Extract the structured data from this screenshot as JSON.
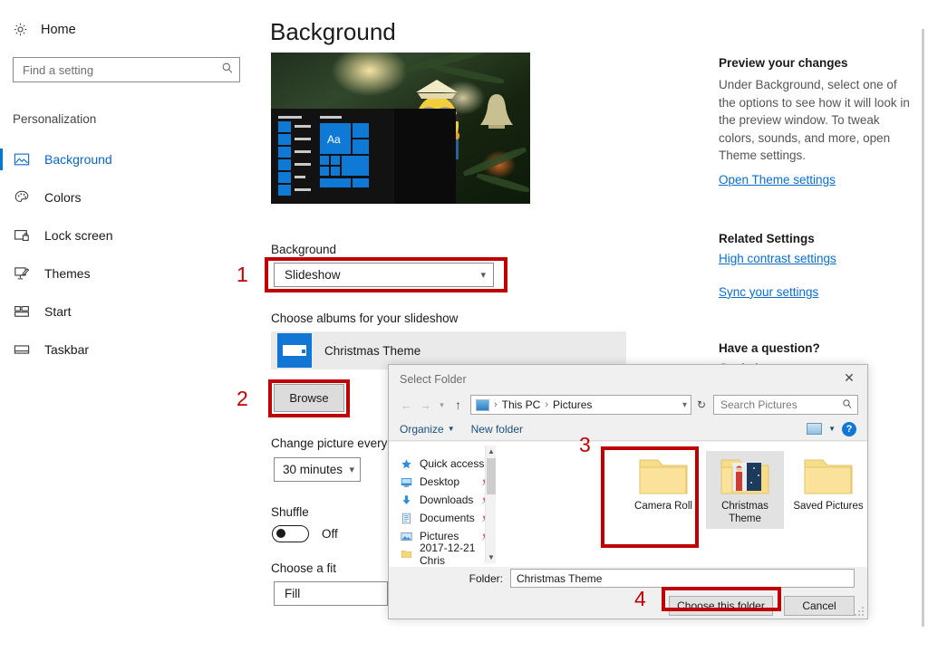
{
  "sidebar": {
    "home_label": "Home",
    "search_placeholder": "Find a setting",
    "section_label": "Personalization",
    "items": [
      {
        "label": "Background",
        "icon": "picture-icon",
        "active": true
      },
      {
        "label": "Colors",
        "icon": "palette-icon",
        "active": false
      },
      {
        "label": "Lock screen",
        "icon": "lock-screen-icon",
        "active": false
      },
      {
        "label": "Themes",
        "icon": "themes-icon",
        "active": false
      },
      {
        "label": "Start",
        "icon": "start-tiles-icon",
        "active": false
      },
      {
        "label": "Taskbar",
        "icon": "taskbar-icon",
        "active": false
      }
    ]
  },
  "main": {
    "page_title": "Background",
    "preview_alt": "Desktop preview showing Christmas minion ornament wallpaper with Start menu",
    "background_label": "Background",
    "background_value": "Slideshow",
    "albums_label": "Choose albums for your slideshow",
    "album_name": "Christmas Theme",
    "browse_label": "Browse",
    "change_picture_label": "Change picture every",
    "change_picture_value": "30 minutes",
    "shuffle_label": "Shuffle",
    "shuffle_state": "Off",
    "fit_label": "Choose a fit",
    "fit_value": "Fill"
  },
  "help": {
    "preview_heading": "Preview your changes",
    "preview_body": "Under Background, select one of the options to see how it will look in the preview window. To tweak colors, sounds, and more, open Theme settings.",
    "open_theme_link": "Open Theme settings",
    "related_heading": "Related Settings",
    "high_contrast_link": "High contrast settings",
    "sync_link": "Sync your settings",
    "question_heading": "Have a question?",
    "get_help_link": "Get help"
  },
  "dialog": {
    "title": "Select Folder",
    "close_icon": "close-icon",
    "breadcrumb": [
      "This PC",
      "Pictures"
    ],
    "search_placeholder": "Search Pictures",
    "organize_label": "Organize",
    "new_folder_label": "New folder",
    "nav_items": [
      {
        "label": "Quick access",
        "icon": "star-icon",
        "pinned": false
      },
      {
        "label": "Desktop",
        "icon": "desktop-icon",
        "pinned": true
      },
      {
        "label": "Downloads",
        "icon": "downloads-icon",
        "pinned": true
      },
      {
        "label": "Documents",
        "icon": "documents-icon",
        "pinned": true
      },
      {
        "label": "Pictures",
        "icon": "pictures-icon",
        "pinned": true
      },
      {
        "label": "2017-12-21 Chris",
        "icon": "folder-icon",
        "pinned": false
      }
    ],
    "folders": [
      {
        "name": "Camera Roll",
        "selected": false
      },
      {
        "name": "Christmas Theme",
        "selected": true
      },
      {
        "name": "Saved Pictures",
        "selected": false
      }
    ],
    "folder_field_label": "Folder:",
    "folder_field_value": "Christmas Theme",
    "choose_button": "Choose this folder",
    "cancel_button": "Cancel"
  },
  "annotations": {
    "accent_color": "#c00000",
    "steps": [
      {
        "number": "1",
        "target": "background-dropdown"
      },
      {
        "number": "2",
        "target": "browse-button"
      },
      {
        "number": "3",
        "target": "christmas-theme-folder"
      },
      {
        "number": "4",
        "target": "choose-this-folder-button"
      }
    ]
  }
}
